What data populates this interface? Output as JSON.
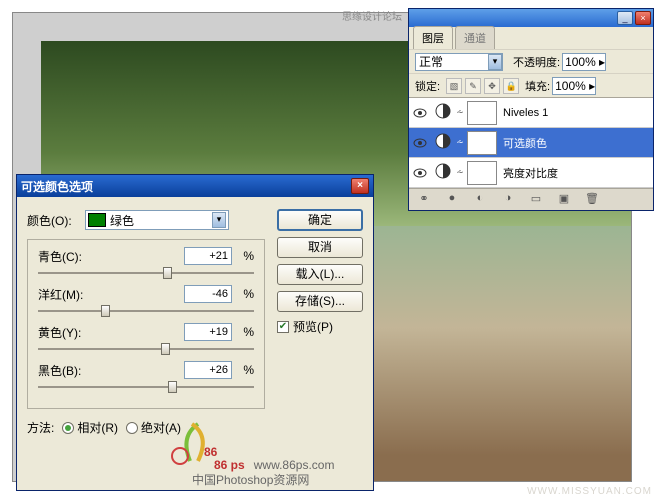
{
  "dialog": {
    "title": "可选颜色选项",
    "color_label": "颜色(O):",
    "color_value": "绿色",
    "sliders": {
      "cyan": {
        "label": "青色(C):",
        "value": "+21",
        "pct": "%",
        "pos": 58
      },
      "magenta": {
        "label": "洋红(M):",
        "value": "-46",
        "pct": "%",
        "pos": 29
      },
      "yellow": {
        "label": "黄色(Y):",
        "value": "+19",
        "pct": "%",
        "pos": 57
      },
      "black": {
        "label": "黑色(B):",
        "value": "+26",
        "pct": "%",
        "pos": 60
      }
    },
    "method_label": "方法:",
    "method_rel": "相对(R)",
    "method_abs": "绝对(A)",
    "buttons": {
      "ok": "确定",
      "cancel": "取消",
      "load": "载入(L)...",
      "save": "存储(S)..."
    },
    "preview": "预览(P)"
  },
  "panel": {
    "tab_layers": "图层",
    "tab_channels": "通道",
    "blend_mode": "正常",
    "opacity_label": "不透明度:",
    "opacity": "100%",
    "dd": "▸",
    "lock_label": "锁定:",
    "fill_label": "填充:",
    "fill": "100%",
    "dd2": "▸",
    "layers": [
      {
        "name": "Niveles 1"
      },
      {
        "name": "可选颜色"
      },
      {
        "name": "亮度对比度"
      }
    ]
  },
  "watermark": {
    "site": "www.86ps.com",
    "line": "中国Photoshop资源网",
    "logo": "86 ps"
  },
  "tr": "思缘设计论坛",
  "br": "WWW.MISSYUAN.COM"
}
